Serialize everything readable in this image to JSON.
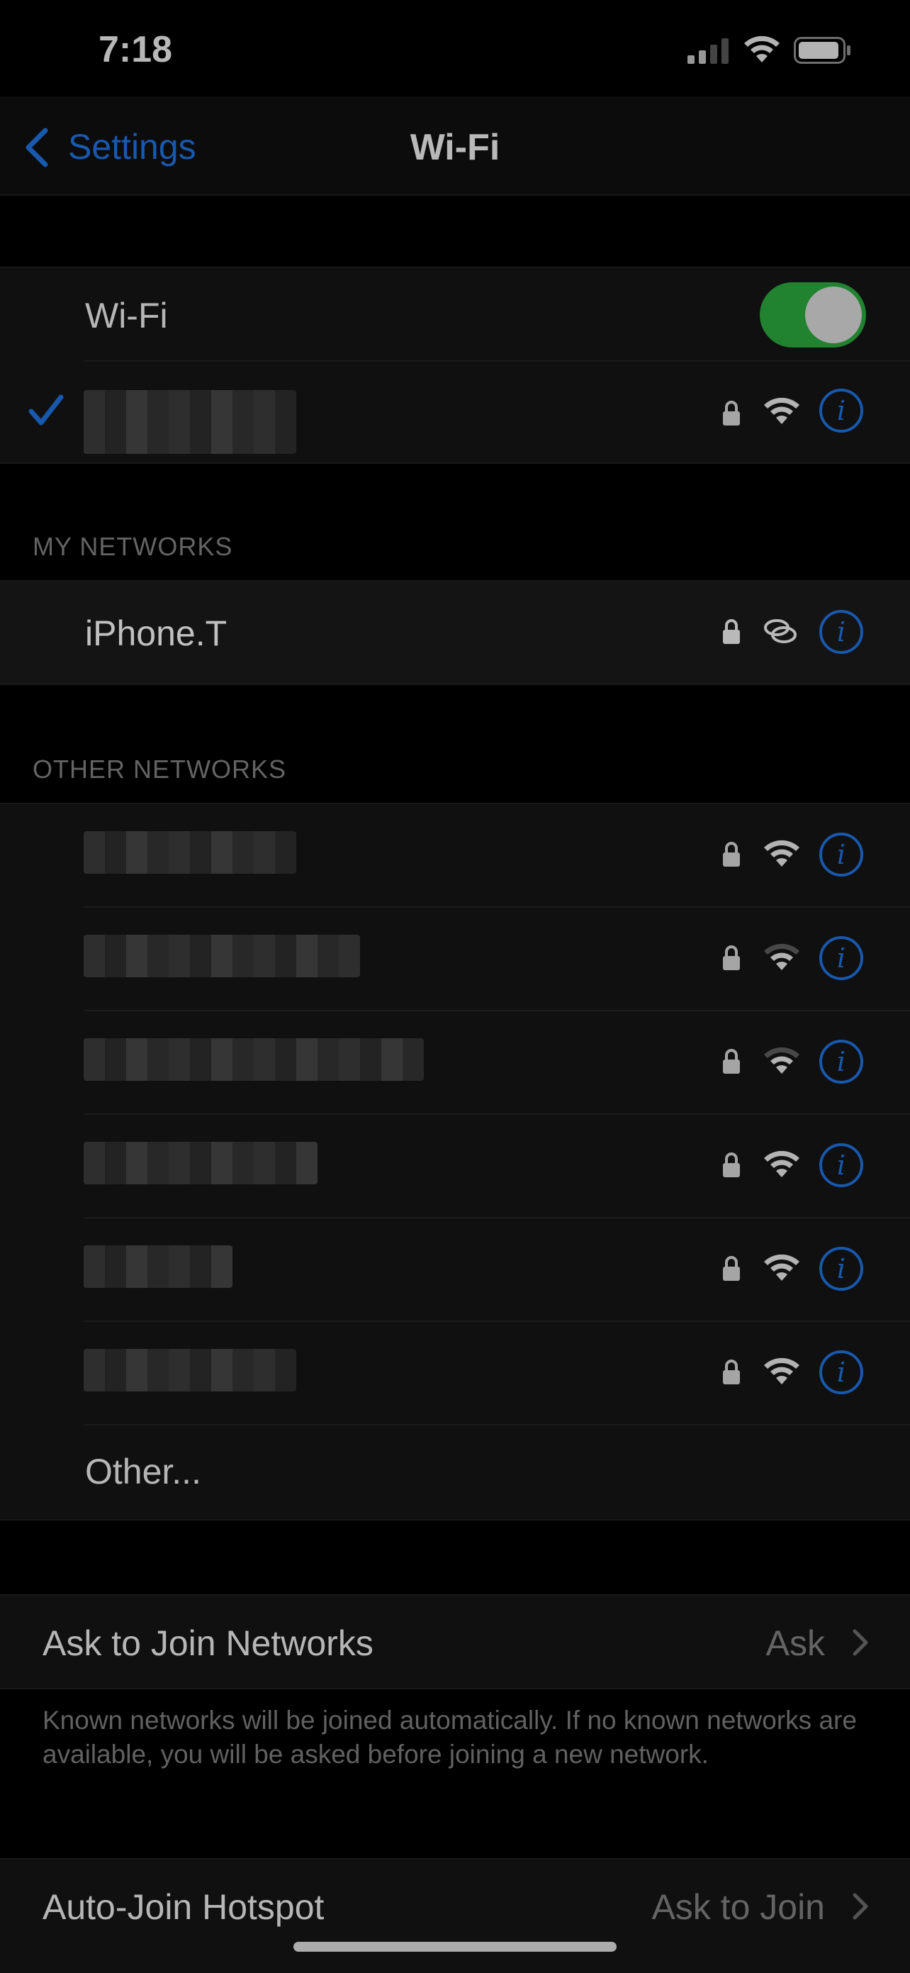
{
  "status_bar": {
    "time": "7:18"
  },
  "nav": {
    "back_label": "Settings",
    "title": "Wi-Fi"
  },
  "wifi_toggle": {
    "label": "Wi-Fi",
    "on": true
  },
  "my_networks": {
    "header": "MY NETWORKS",
    "items": [
      {
        "name": "iPhone.T"
      }
    ]
  },
  "other_networks": {
    "header": "OTHER NETWORKS",
    "other_label": "Other..."
  },
  "ask_to_join": {
    "label": "Ask to Join Networks",
    "value": "Ask",
    "footnote": "Known networks will be joined automatically. If no known networks are available, you will be asked before joining a new network."
  },
  "auto_join_hotspot": {
    "label": "Auto-Join Hotspot",
    "value": "Ask to Join"
  },
  "colors": {
    "accent": "#1e6fd9",
    "toggle_on": "#2aa33d",
    "background": "#000000",
    "cell": "#141414"
  },
  "icons": [
    "back-chevron-icon",
    "checkmark-icon",
    "lock-icon",
    "wifi-signal-icon",
    "info-icon",
    "hotspot-link-icon",
    "chevron-right-icon",
    "battery-icon",
    "cellular-signal-icon"
  ]
}
